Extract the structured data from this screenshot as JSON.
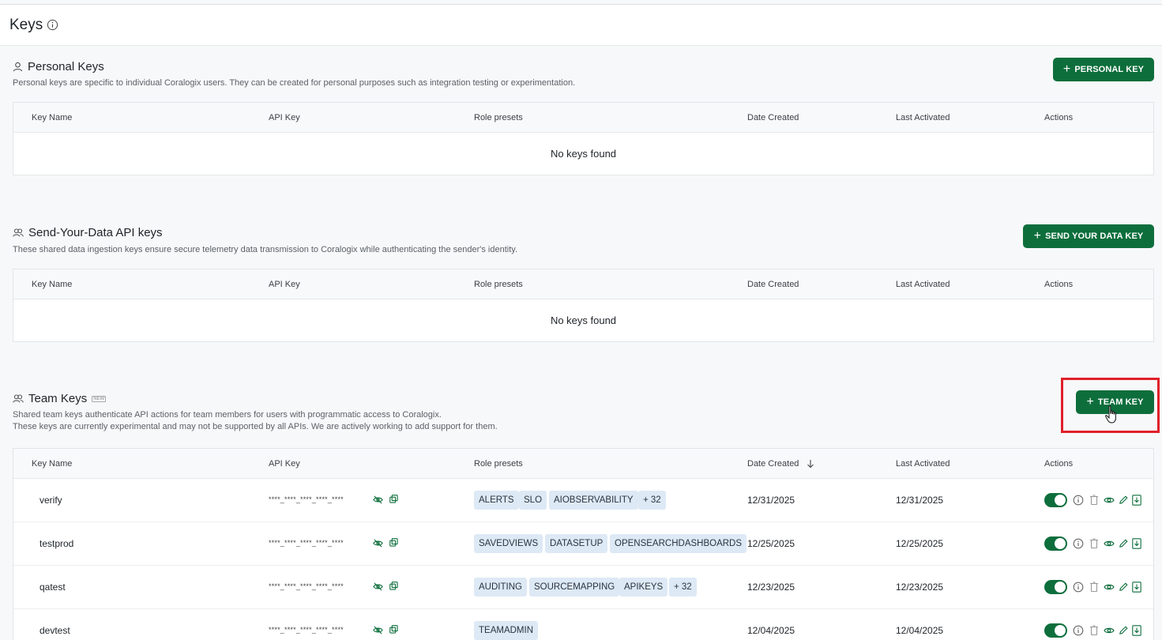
{
  "page": {
    "title": "Keys"
  },
  "personal": {
    "title": "Personal Keys",
    "description": "Personal keys are specific to individual Coralogix users. They can be created for personal purposes such as integration testing or experimentation.",
    "button": "PERSONAL KEY",
    "empty": "No keys found"
  },
  "send_data": {
    "title": "Send-Your-Data API keys",
    "description": "These shared data ingestion keys ensure secure telemetry data transmission to Coralogix while authenticating the sender's identity.",
    "button": "SEND YOUR DATA KEY",
    "empty": "No keys found"
  },
  "team": {
    "title": "Team Keys",
    "badge": "NEW",
    "description_1": "Shared team keys authenticate API actions for team members for users with programmatic access to Coralogix.",
    "description_2": "These keys are currently experimental and may not be supported by all APIs. We are actively working to add support for them.",
    "button": "TEAM KEY",
    "rows": [
      {
        "name": "verify",
        "api_key": "****_****_****_****_****",
        "roles": [
          "ALERTS",
          "SLO",
          "AIOBSERVABILITY",
          "+ 32"
        ],
        "date_created": "12/31/2025",
        "last_activated": "12/31/2025"
      },
      {
        "name": "testprod",
        "api_key": "****_****_****_****_****",
        "roles": [
          "SAVEDVIEWS",
          "DATASETUP",
          "OPENSEARCHDASHBOARDS"
        ],
        "date_created": "12/25/2025",
        "last_activated": "12/25/2025"
      },
      {
        "name": "qatest",
        "api_key": "****_****_****_****_****",
        "roles": [
          "AUDITING",
          "SOURCEMAPPING",
          "APIKEYS",
          "+ 32"
        ],
        "date_created": "12/23/2025",
        "last_activated": "12/23/2025"
      },
      {
        "name": "devtest",
        "api_key": "****_****_****_****_****",
        "roles": [
          "TEAMADMIN"
        ],
        "date_created": "12/04/2025",
        "last_activated": "12/04/2025"
      }
    ]
  },
  "columns": {
    "key_name": "Key Name",
    "api_key": "API Key",
    "role_presets": "Role presets",
    "date_created": "Date Created",
    "last_activated": "Last Activated",
    "actions": "Actions"
  },
  "colors": {
    "primary": "#0d6e3c",
    "tag_bg": "#dde9f5",
    "highlight": "#e0202a"
  }
}
